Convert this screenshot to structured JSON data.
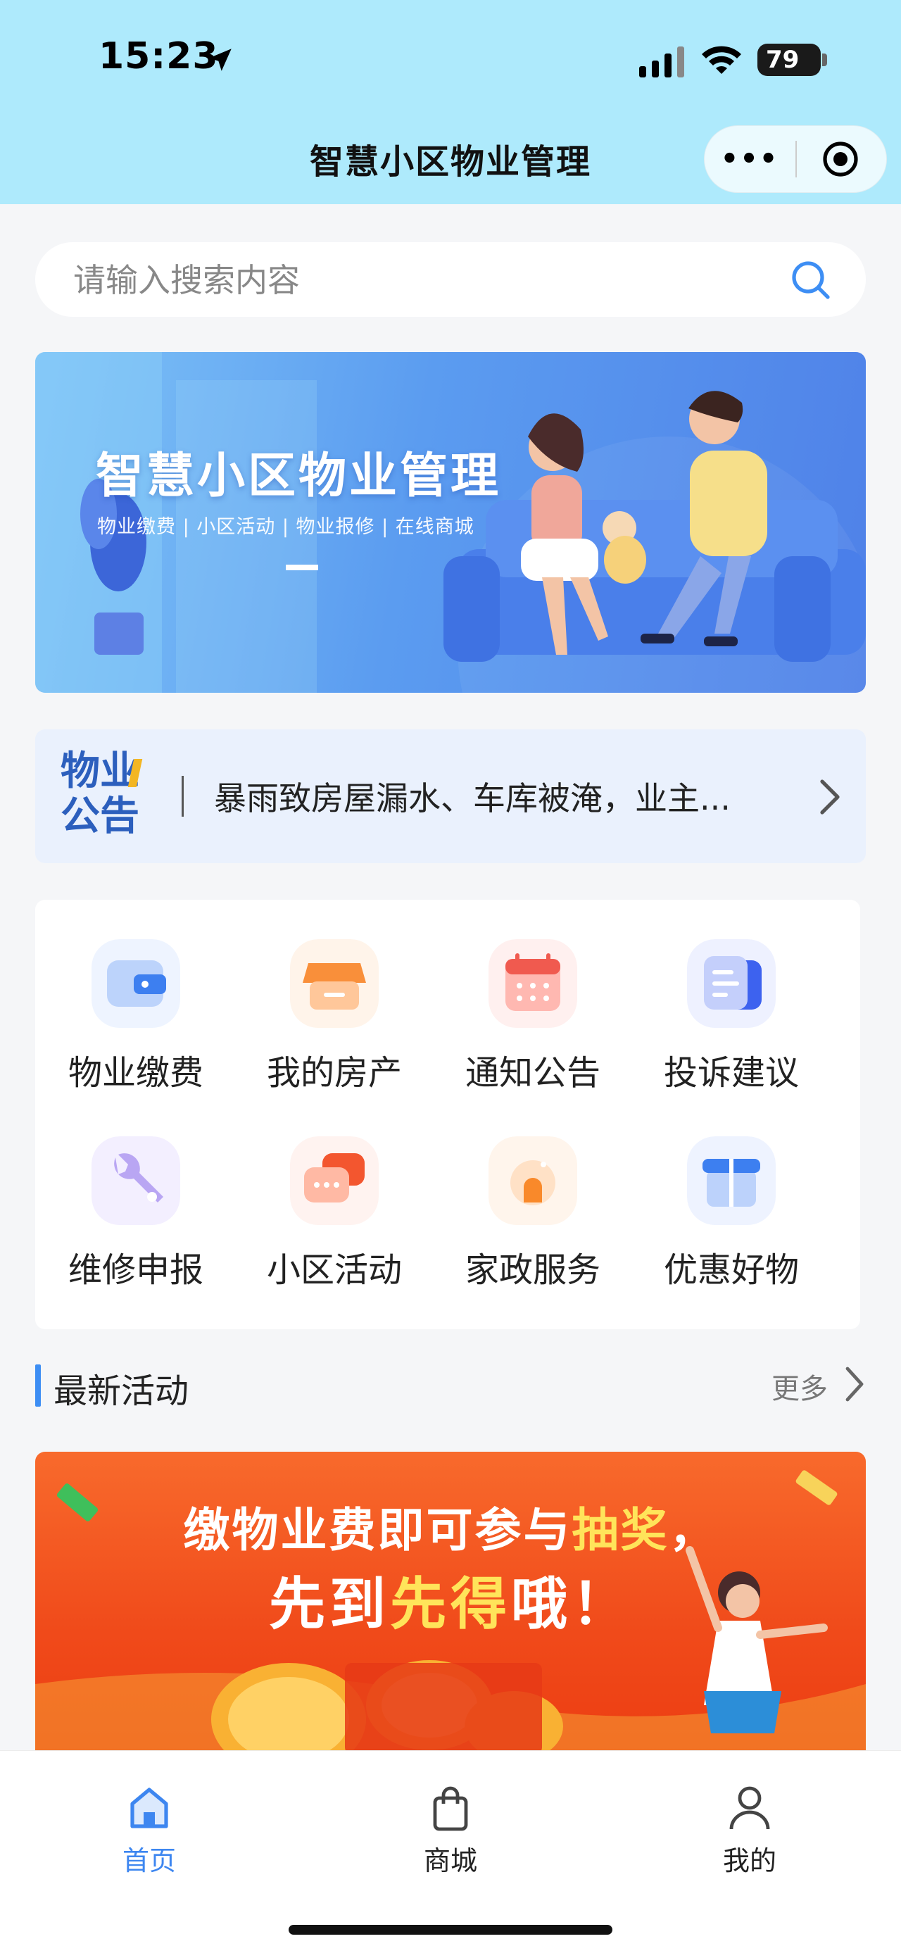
{
  "status_bar": {
    "time": "15:23",
    "battery": "79"
  },
  "nav": {
    "title": "智慧小区物业管理"
  },
  "search": {
    "placeholder": "请输入搜索内容"
  },
  "banner": {
    "title": "智慧小区物业管理",
    "subtitle": "物业缴费 | 小区活动 | 物业报修 | 在线商城"
  },
  "notice": {
    "logo_line1": "物业",
    "logo_line2": "公告",
    "text": "暴雨致房屋漏水、车库被淹，业主..."
  },
  "services": [
    {
      "label": "物业缴费",
      "icon": "wallet-icon"
    },
    {
      "label": "我的房产",
      "icon": "house-store-icon"
    },
    {
      "label": "通知公告",
      "icon": "calendar-icon"
    },
    {
      "label": "投诉建议",
      "icon": "document-icon"
    },
    {
      "label": "维修申报",
      "icon": "wrench-icon"
    },
    {
      "label": "小区活动",
      "icon": "chat-bubbles-icon"
    },
    {
      "label": "家政服务",
      "icon": "home-service-icon"
    },
    {
      "label": "优惠好物",
      "icon": "gift-icon"
    }
  ],
  "activities": {
    "title": "最新活动",
    "more": "更多",
    "promo": {
      "line1_a": "缴物业费即可参与",
      "line1_b": "抽奖",
      "line1_c": "，",
      "line2_a": "先到",
      "line2_b": "先得",
      "line2_c": "哦！"
    }
  },
  "tabs": [
    {
      "label": "首页",
      "icon": "home-icon",
      "active": true
    },
    {
      "label": "商城",
      "icon": "shopping-bag-icon",
      "active": false
    },
    {
      "label": "我的",
      "icon": "user-icon",
      "active": false
    }
  ],
  "colors": {
    "accent": "#3d86f0",
    "header": "#aeeafc",
    "promo": "#f04a1a",
    "highlight": "#ffe45a"
  }
}
